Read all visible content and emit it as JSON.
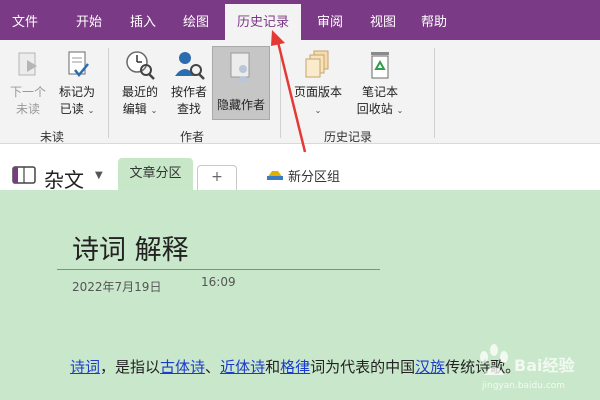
{
  "menu": {
    "tabs": [
      "文件",
      "开始",
      "插入",
      "绘图",
      "历史记录",
      "审阅",
      "视图",
      "帮助"
    ],
    "active_index": 4
  },
  "ribbon": {
    "unread_group": {
      "label": "未读",
      "next_unread": [
        "下一个",
        "未读"
      ],
      "mark_read": [
        "标记为",
        "已读"
      ]
    },
    "author_group": {
      "label": "作者",
      "recent_edits": [
        "最近的",
        "编辑"
      ],
      "find_by_author": [
        "按作者",
        "查找"
      ],
      "hide_authors": "隐藏作者"
    },
    "history_group": {
      "label": "历史记录",
      "page_versions": "页面版本",
      "notebook_recycle": [
        "笔记本",
        "回收站"
      ]
    }
  },
  "notebook": {
    "name": "杂文",
    "section_tab": "文章分区",
    "add_tab": "+",
    "new_section_group": "新分区组"
  },
  "page": {
    "title": "诗词 解释",
    "date": "2022年7月19日",
    "time": "16:09",
    "body": [
      {
        "text": "诗词",
        "link": true
      },
      {
        "text": "，是指以",
        "link": false
      },
      {
        "text": "古体诗",
        "link": true
      },
      {
        "text": "、",
        "link": false
      },
      {
        "text": "近体诗",
        "link": true
      },
      {
        "text": "和",
        "link": false
      },
      {
        "text": "格律",
        "link": true
      },
      {
        "text": "词为代表的中国",
        "link": false
      },
      {
        "text": "汉族",
        "link": true
      },
      {
        "text": "传统诗歌。",
        "link": false
      }
    ]
  },
  "watermark": {
    "brand": "Baidu经验",
    "url": "jingyan.baidu.com"
  },
  "colors": {
    "menu_bg": "#7b3a86",
    "page_bg": "#c9e7ca",
    "link": "#1a3bcc",
    "arrow": "#e53935"
  }
}
